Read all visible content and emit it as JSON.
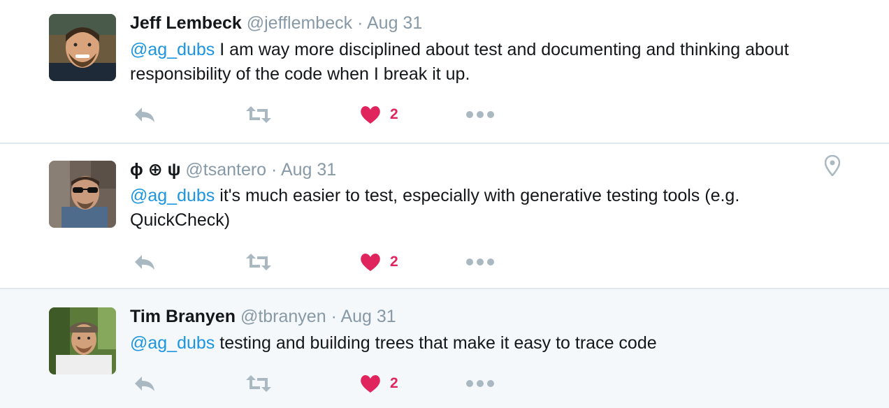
{
  "colors": {
    "mention": "#1b95e0",
    "like": "#e0245e",
    "meta": "#8899a6",
    "action_icon": "#aab8c2",
    "divider": "#e1e8ed",
    "highlight_bg": "#f5f8fa"
  },
  "tweets": [
    {
      "name": "Jeff Lembeck",
      "handle": "@jefflembeck",
      "separator": "·",
      "date": "Aug 31",
      "mention": "@ag_dubs",
      "text": " I am way more disciplined about test and documenting and thinking about responsibility of the code when I break it up.",
      "like_count": "2",
      "icons": [
        "reply-icon",
        "retweet-icon",
        "heart-icon",
        "more-icon"
      ]
    },
    {
      "name": "ϕ ⊕ ψ",
      "handle": "@tsantero",
      "separator": "·",
      "date": "Aug 31",
      "mention": "@ag_dubs",
      "text": " it's much easier to test, especially with generative testing tools (e.g. QuickCheck)",
      "like_count": "2",
      "has_location": true,
      "icons": [
        "reply-icon",
        "retweet-icon",
        "heart-icon",
        "more-icon",
        "location-pin-icon"
      ]
    },
    {
      "name": "Tim Branyen",
      "handle": "@tbranyen",
      "separator": "·",
      "date": "Aug 31",
      "mention": "@ag_dubs",
      "text": " testing and building trees that make it easy to trace code",
      "like_count": "2",
      "icons": [
        "reply-icon",
        "retweet-icon",
        "heart-icon",
        "more-icon"
      ]
    }
  ]
}
